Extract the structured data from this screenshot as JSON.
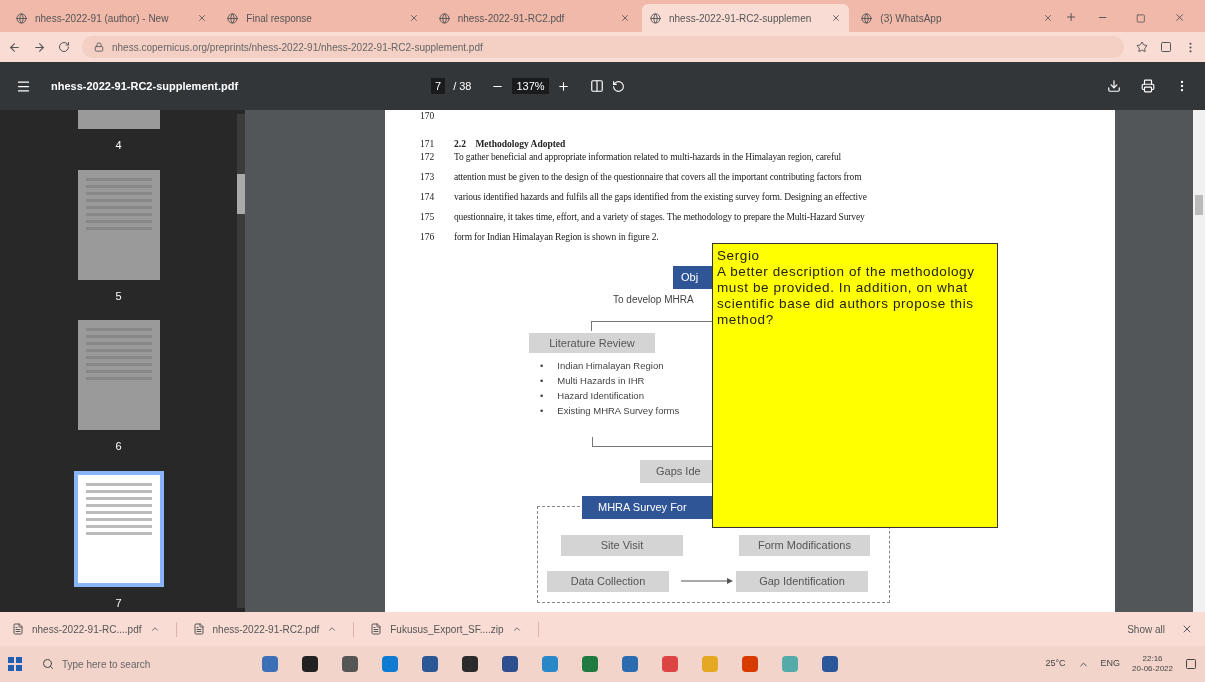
{
  "tabs": [
    {
      "label": "nhess-2022-91 (author) - New",
      "selected": false
    },
    {
      "label": "Final response",
      "selected": false
    },
    {
      "label": "nhess-2022-91-RC2.pdf",
      "selected": false
    },
    {
      "label": "nhess-2022-91-RC2-supplemen",
      "selected": true
    },
    {
      "label": "(3) WhatsApp",
      "selected": false
    }
  ],
  "address": {
    "url": "nhess.copernicus.org/preprints/nhess-2022-91/nhess-2022-91-RC2-supplement.pdf"
  },
  "pdf_toolbar": {
    "filename": "nhess-2022-91-RC2-supplement.pdf",
    "page": "7",
    "page_count": "/ 38",
    "zoom": "137%"
  },
  "thumbnails": [
    {
      "label": "4",
      "selected": false
    },
    {
      "label": "5",
      "selected": false
    },
    {
      "label": "6",
      "selected": false
    },
    {
      "label": "7",
      "selected": true
    }
  ],
  "document": {
    "lines": [
      {
        "number": "170",
        "kind": "blank"
      },
      {
        "number": "171",
        "kind": "heading",
        "section": "2.2",
        "text": "Methodology Adopted"
      },
      {
        "number": "172",
        "kind": "text",
        "text": "To gather beneficial and appropriate information related to multi-hazards in the Himalayan region, careful"
      },
      {
        "number": "173",
        "kind": "text",
        "text": "attention must be given to the design of the questionnaire that covers all the important contributing factors from"
      },
      {
        "number": "174",
        "kind": "text",
        "text": "various identified hazards and fulfils all the gaps identified from the existing survey form. Designing an effective"
      },
      {
        "number": "175",
        "kind": "text",
        "text": "questionnaire, it takes time, effort, and a variety of stages. The methodology to prepare the Multi-Hazard Survey"
      },
      {
        "number": "176",
        "kind": "text",
        "text": "form for Indian Himalayan Region is shown in figure 2."
      }
    ],
    "flowchart": {
      "objective": "Obj",
      "objective_text": "To develop MHRA",
      "literature": "Literature Review",
      "bullets": [
        {
          "marker": "•",
          "text": "Indian Himalayan Region"
        },
        {
          "marker": "•",
          "text": "Multi Hazards in IHR"
        },
        {
          "marker": "•",
          "text": "Hazard Identification"
        },
        {
          "marker": "•",
          "text": "Existing MHRA Survey forms"
        }
      ],
      "gaps": "Gaps Ide",
      "survey": "MHRA Survey For",
      "site_visit": "Site Visit",
      "form_modifications": "Form Modifications",
      "data_collection": "Data Collection",
      "gap_identification": "Gap Identification"
    }
  },
  "comment": {
    "author": "Sergio",
    "text": "A better description of the methodology must be provided. In addition, on what scientific base did authors propose this method?"
  },
  "downloads": [
    {
      "name": "nhess-2022-91-RC....pdf"
    },
    {
      "name": "nhess-2022-91-RC2.pdf"
    },
    {
      "name": "Fukusus_Export_SF....zip"
    }
  ],
  "show_all": "Show all",
  "taskbar": {
    "search_placeholder": "Type here to search",
    "weather": "25°C",
    "language": "ENG",
    "time": "22:16",
    "date": "20-06-2022"
  }
}
